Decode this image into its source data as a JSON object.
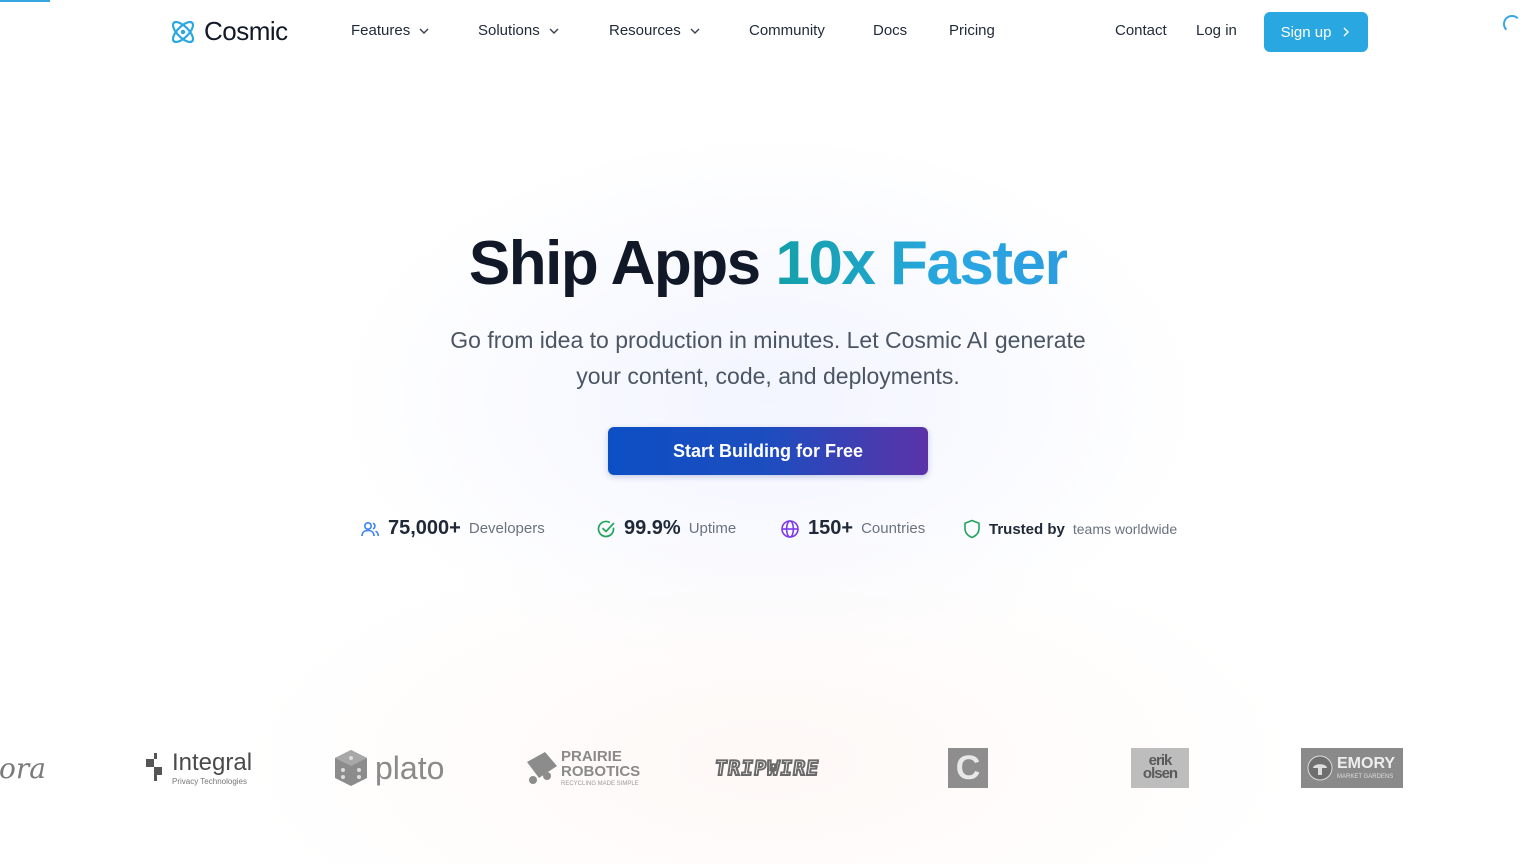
{
  "nav": {
    "brand": "Cosmic",
    "items": [
      {
        "label": "Features",
        "dropdown": true
      },
      {
        "label": "Solutions",
        "dropdown": true
      },
      {
        "label": "Resources",
        "dropdown": true
      },
      {
        "label": "Community",
        "dropdown": false
      },
      {
        "label": "Docs",
        "dropdown": false
      },
      {
        "label": "Pricing",
        "dropdown": false
      }
    ],
    "contact": "Contact",
    "login": "Log in",
    "signup": "Sign up"
  },
  "hero": {
    "title_plain": "Ship Apps",
    "title_accent": "10x Faster",
    "subtitle": "Go from idea to production in minutes. Let Cosmic AI generate your content, code, and deployments.",
    "cta": "Start Building for Free"
  },
  "stats": [
    {
      "value": "75,000+",
      "label": "Developers",
      "icon": "users-icon"
    },
    {
      "value": "99.9%",
      "label": "Uptime",
      "icon": "check-circle-icon"
    },
    {
      "value": "150+",
      "label": "Countries",
      "icon": "globe-icon"
    }
  ],
  "trust": {
    "strong": "Trusted by",
    "light": "teams worldwide",
    "icon": "shield-icon"
  },
  "logos": [
    {
      "name": "lora",
      "text": "lora"
    },
    {
      "name": "integral",
      "text": "Integral",
      "sub": "Privacy Technologies"
    },
    {
      "name": "plato",
      "text": "plato"
    },
    {
      "name": "prairie-robotics",
      "text": "PRAIRIE",
      "text2": "ROBOTICS",
      "sub": "RECYCLING MADE SIMPLE"
    },
    {
      "name": "tripwire",
      "text": "TRIPWIRE"
    },
    {
      "name": "c-logo",
      "text": "C"
    },
    {
      "name": "erik-olsen",
      "text": "erik",
      "text2": "olsen"
    },
    {
      "name": "emory",
      "text": "EMORY",
      "sub": "MARKET GARDENS"
    }
  ],
  "colors": {
    "accent": "#29a7e1",
    "teal": "#13a0a8",
    "cta_start": "#0c4fc4",
    "cta_end": "#5b33a8",
    "users_icon": "#3b82f6",
    "check_icon": "#22a55b",
    "globe_icon": "#7c3aed",
    "shield_icon": "#22a55b"
  }
}
